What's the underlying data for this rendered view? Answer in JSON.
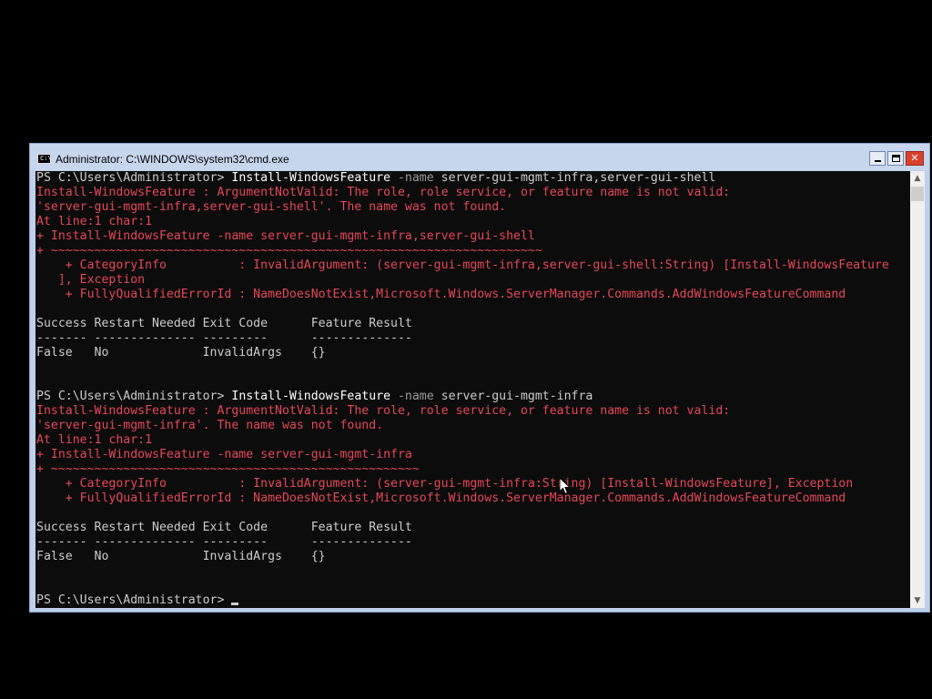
{
  "window": {
    "title": "Administrator: C:\\WINDOWS\\system32\\cmd.exe",
    "icon": "cmd-icon",
    "icon_text": "C:\\",
    "buttons": {
      "minimize": "minimize-icon",
      "maximize": "maximize-icon",
      "close": "close-icon"
    }
  },
  "colors": {
    "console_background": "#0c0c0c",
    "text": "#cccccc",
    "command": "#ffffff",
    "parameter": "#9a9a9a",
    "error": "#e74856",
    "titlebar": "#c6d6ec"
  },
  "console": {
    "lines": [
      {
        "type": "command",
        "prompt": "PS C:\\Users\\Administrator> ",
        "cmdlet": "Install-WindowsFeature",
        "param": " -name",
        "args": " server-gui-mgmt-infra,server-gui-shell"
      },
      {
        "type": "error",
        "text": "Install-WindowsFeature : ArgumentNotValid: The role, role service, or feature name is not valid:"
      },
      {
        "type": "error",
        "text": "'server-gui-mgmt-infra,server-gui-shell'. The name was not found."
      },
      {
        "type": "error",
        "text": "At line:1 char:1"
      },
      {
        "type": "error",
        "text": "+ Install-WindowsFeature -name server-gui-mgmt-infra,server-gui-shell"
      },
      {
        "type": "error",
        "text": "+ ~~~~~~~~~~~~~~~~~~~~~~~~~~~~~~~~~~~~~~~~~~~~~~~~~~~~~~~~~~~~~~~~~~~~"
      },
      {
        "type": "error",
        "text": "    + CategoryInfo          : InvalidArgument: (server-gui-mgmt-infra,server-gui-shell:String) [Install-WindowsFeature"
      },
      {
        "type": "error",
        "text": "   ], Exception"
      },
      {
        "type": "error",
        "text": "    + FullyQualifiedErrorId : NameDoesNotExist,Microsoft.Windows.ServerManager.Commands.AddWindowsFeatureCommand"
      },
      {
        "type": "blank",
        "text": ""
      },
      {
        "type": "output",
        "text": "Success Restart Needed Exit Code      Feature Result"
      },
      {
        "type": "output",
        "text": "------- -------------- ---------      --------------"
      },
      {
        "type": "output",
        "text": "False   No             InvalidArgs    {}"
      },
      {
        "type": "blank",
        "text": ""
      },
      {
        "type": "blank",
        "text": ""
      },
      {
        "type": "command",
        "prompt": "PS C:\\Users\\Administrator> ",
        "cmdlet": "Install-WindowsFeature",
        "param": " -name",
        "args": " server-gui-mgmt-infra"
      },
      {
        "type": "error",
        "text": "Install-WindowsFeature : ArgumentNotValid: The role, role service, or feature name is not valid:"
      },
      {
        "type": "error",
        "text": "'server-gui-mgmt-infra'. The name was not found."
      },
      {
        "type": "error",
        "text": "At line:1 char:1"
      },
      {
        "type": "error",
        "text": "+ Install-WindowsFeature -name server-gui-mgmt-infra"
      },
      {
        "type": "error",
        "text": "+ ~~~~~~~~~~~~~~~~~~~~~~~~~~~~~~~~~~~~~~~~~~~~~~~~~~~"
      },
      {
        "type": "error",
        "text": "    + CategoryInfo          : InvalidArgument: (server-gui-mgmt-infra:String) [Install-WindowsFeature], Exception"
      },
      {
        "type": "error",
        "text": "    + FullyQualifiedErrorId : NameDoesNotExist,Microsoft.Windows.ServerManager.Commands.AddWindowsFeatureCommand"
      },
      {
        "type": "blank",
        "text": ""
      },
      {
        "type": "output",
        "text": "Success Restart Needed Exit Code      Feature Result"
      },
      {
        "type": "output",
        "text": "------- -------------- ---------      --------------"
      },
      {
        "type": "output",
        "text": "False   No             InvalidArgs    {}"
      },
      {
        "type": "blank",
        "text": ""
      },
      {
        "type": "blank",
        "text": ""
      },
      {
        "type": "prompt",
        "prompt": "PS C:\\Users\\Administrator> "
      }
    ]
  },
  "scrollbar": {
    "up_icon": "scroll-up-arrow-icon",
    "down_icon": "scroll-down-arrow-icon",
    "up_glyph": "▲",
    "down_glyph": "▼"
  },
  "pointer": {
    "icon": "mouse-pointer-icon"
  }
}
